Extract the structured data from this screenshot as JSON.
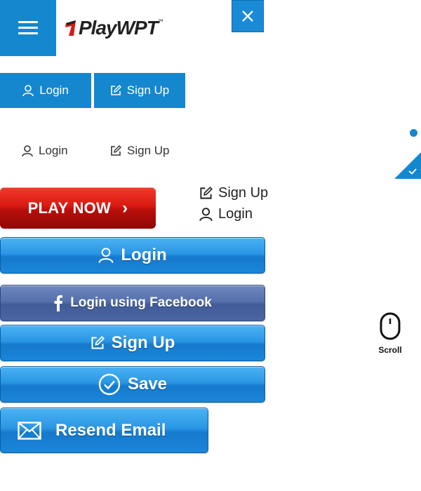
{
  "brand": {
    "logo_text": "PlayWPT",
    "trademark": "™"
  },
  "header": {
    "menu_icon": "hamburger-menu-icon",
    "close_icon": "close-icon"
  },
  "flat_buttons": {
    "login": "Login",
    "signup": "Sign Up"
  },
  "plain_links": {
    "login": "Login",
    "signup": "Sign Up"
  },
  "side_links": {
    "signup": "Sign Up",
    "login": "Login"
  },
  "play_now": {
    "label": "PLAY NOW",
    "chevron": "›"
  },
  "glossy_buttons": {
    "login": "Login",
    "facebook": "Login using Facebook",
    "signup": "Sign Up",
    "save": "Save",
    "resend": "Resend Email"
  },
  "scroll": {
    "label": "Scroll"
  },
  "colors": {
    "primary_blue": "#1587cf",
    "play_red": "#d81a12",
    "facebook_blue": "#4c66a3"
  }
}
